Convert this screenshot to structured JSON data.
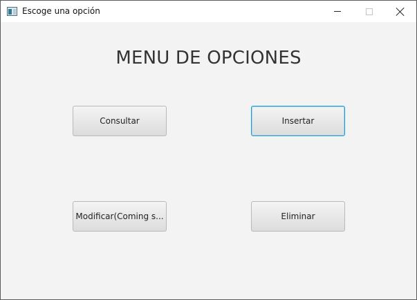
{
  "window": {
    "title": "Escoge una opción",
    "icon": "java-app-icon",
    "controls": [
      "minimize-icon",
      "maximize-icon",
      "close-icon"
    ]
  },
  "main": {
    "heading": "MENU DE OPCIONES",
    "buttons": [
      {
        "label": "Consultar",
        "focused": false
      },
      {
        "label": "Insertar",
        "focused": true
      },
      {
        "label": "Modificar(Coming s...",
        "focused": false
      },
      {
        "label": "Eliminar",
        "focused": false
      }
    ]
  },
  "colors": {
    "background": "#f3f3f3",
    "focus_border": "#1d9bd7"
  }
}
